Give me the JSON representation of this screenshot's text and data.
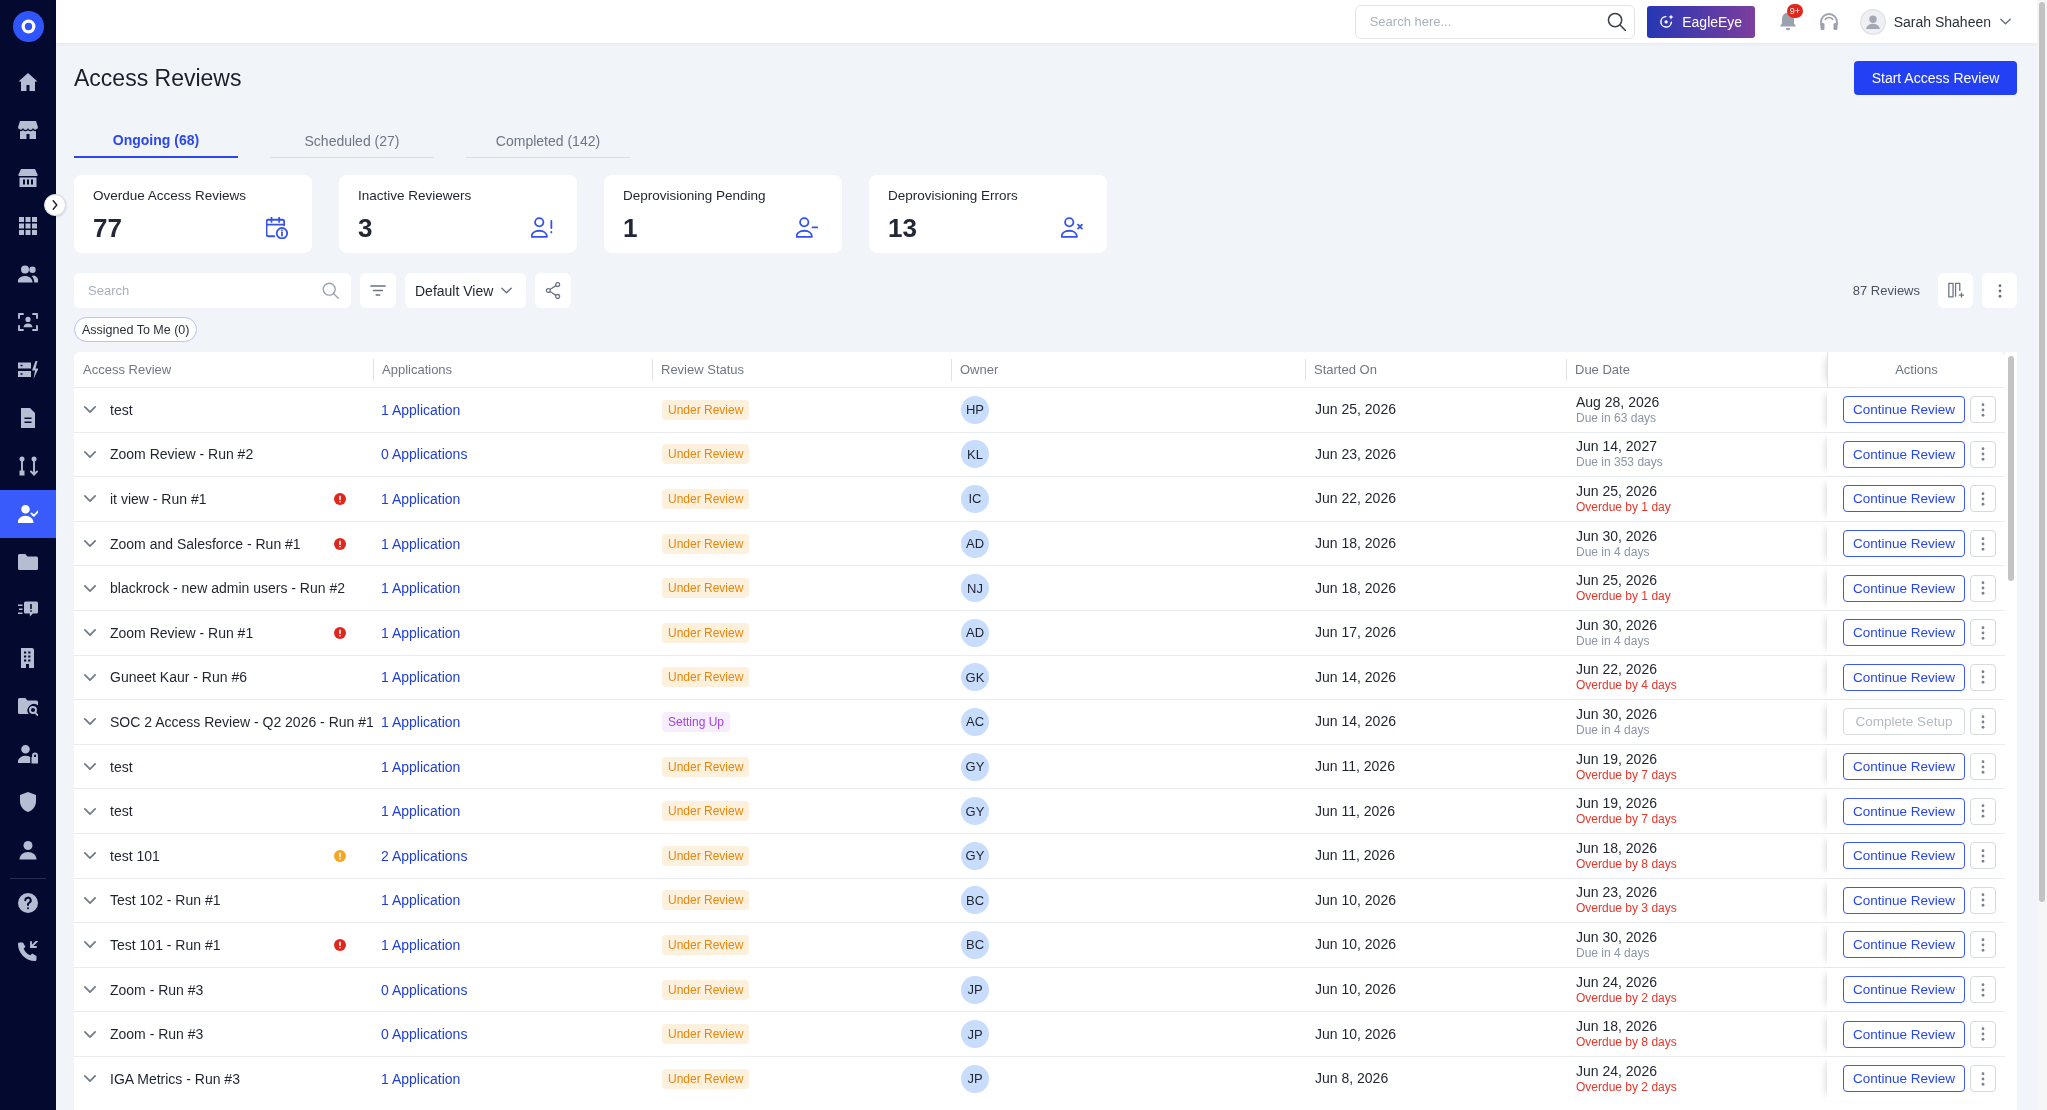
{
  "sidebar": {
    "items": [
      {
        "selected": false
      },
      {
        "selected": false
      },
      {
        "selected": false
      },
      {
        "selected": false
      },
      {
        "selected": false
      },
      {
        "selected": false
      },
      {
        "selected": false
      },
      {
        "selected": false
      },
      {
        "selected": false
      },
      {
        "selected": true
      },
      {
        "selected": false
      },
      {
        "selected": false
      },
      {
        "selected": false
      },
      {
        "selected": false
      },
      {
        "selected": false
      },
      {
        "selected": false
      },
      {
        "selected": false
      }
    ],
    "bottom_items": [
      {
        "selected": false
      },
      {
        "selected": false
      }
    ]
  },
  "topbar": {
    "search": {
      "placeholder": "Search here..."
    },
    "assistant_button": "EagleEye",
    "notification_badge": "9+",
    "user_name": "Sarah Shaheen"
  },
  "page": {
    "title": "Access Reviews",
    "primary_button": "Start Access Review"
  },
  "tabs": [
    {
      "label": "Ongoing (68)",
      "selected": true
    },
    {
      "label": "Scheduled (27)",
      "selected": false
    },
    {
      "label": "Completed (142)",
      "selected": false
    }
  ],
  "cards": [
    {
      "label": "Overdue Access Reviews",
      "value": "77"
    },
    {
      "label": "Inactive Reviewers",
      "value": "3"
    },
    {
      "label": "Deprovisioning Pending",
      "value": "1"
    },
    {
      "label": "Deprovisioning Errors",
      "value": "13"
    }
  ],
  "toolbar": {
    "search": {
      "placeholder": "Search"
    },
    "view": "Default View",
    "count": "87 Reviews",
    "filter_chip": "Assigned To Me (0)"
  },
  "table": {
    "columns": [
      "Access Review",
      "Applications",
      "Review Status",
      "Owner",
      "Started On",
      "Due Date",
      "Actions"
    ],
    "rows": [
      {
        "name": "test",
        "applications": "1 Application",
        "status": {
          "label": "Under Review",
          "kind": "review"
        },
        "owner": "HP",
        "started_on": "Jun 25, 2026",
        "due": {
          "date": "Aug 28, 2026",
          "note": "Due in 63 days",
          "overdue": false
        },
        "action": {
          "label": "Continue Review",
          "disabled": false
        }
      },
      {
        "name": "Zoom Review - Run #2",
        "applications": "0 Applications",
        "status": {
          "label": "Under Review",
          "kind": "review"
        },
        "owner": "KL",
        "started_on": "Jun 23, 2026",
        "due": {
          "date": "Jun 14, 2027",
          "note": "Due in 353 days",
          "overdue": false
        },
        "action": {
          "label": "Continue Review",
          "disabled": false
        }
      },
      {
        "name": "it view - Run #1",
        "alert": {
          "color": "#e0261d"
        },
        "applications": "1 Application",
        "status": {
          "label": "Under Review",
          "kind": "review"
        },
        "owner": "IC",
        "started_on": "Jun 22, 2026",
        "due": {
          "date": "Jun 25, 2026",
          "note": "Overdue by 1 day",
          "overdue": true
        },
        "action": {
          "label": "Continue Review",
          "disabled": false
        }
      },
      {
        "name": "Zoom and Salesforce - Run #1",
        "alert": {
          "color": "#e0261d"
        },
        "applications": "1 Application",
        "status": {
          "label": "Under Review",
          "kind": "review"
        },
        "owner": "AD",
        "started_on": "Jun 18, 2026",
        "due": {
          "date": "Jun 30, 2026",
          "note": "Due in 4 days",
          "overdue": false
        },
        "action": {
          "label": "Continue Review",
          "disabled": false
        }
      },
      {
        "name": "blackrock - new admin users - Run #2",
        "applications": "1 Application",
        "status": {
          "label": "Under Review",
          "kind": "review"
        },
        "owner": "NJ",
        "started_on": "Jun 18, 2026",
        "due": {
          "date": "Jun 25, 2026",
          "note": "Overdue by 1 day",
          "overdue": true
        },
        "action": {
          "label": "Continue Review",
          "disabled": false
        }
      },
      {
        "name": "Zoom Review - Run #1",
        "alert": {
          "color": "#e0261d"
        },
        "applications": "1 Application",
        "status": {
          "label": "Under Review",
          "kind": "review"
        },
        "owner": "AD",
        "started_on": "Jun 17, 2026",
        "due": {
          "date": "Jun 30, 2026",
          "note": "Due in 4 days",
          "overdue": false
        },
        "action": {
          "label": "Continue Review",
          "disabled": false
        }
      },
      {
        "name": "Guneet Kaur - Run #6",
        "applications": "1 Application",
        "status": {
          "label": "Under Review",
          "kind": "review"
        },
        "owner": "GK",
        "started_on": "Jun 14, 2026",
        "due": {
          "date": "Jun 22, 2026",
          "note": "Overdue by 4 days",
          "overdue": true
        },
        "action": {
          "label": "Continue Review",
          "disabled": false
        }
      },
      {
        "name": "SOC 2 Access Review - Q2 2026 - Run #1",
        "applications": "1 Application",
        "status": {
          "label": "Setting Up",
          "kind": "setup"
        },
        "owner": "AC",
        "started_on": "Jun 14, 2026",
        "due": {
          "date": "Jun 30, 2026",
          "note": "Due in 4 days",
          "overdue": false
        },
        "action": {
          "label": "Complete Setup",
          "disabled": true
        }
      },
      {
        "name": "test",
        "applications": "1 Application",
        "status": {
          "label": "Under Review",
          "kind": "review"
        },
        "owner": "GY",
        "started_on": "Jun 11, 2026",
        "due": {
          "date": "Jun 19, 2026",
          "note": "Overdue by 7 days",
          "overdue": true
        },
        "action": {
          "label": "Continue Review",
          "disabled": false
        }
      },
      {
        "name": "test",
        "applications": "1 Application",
        "status": {
          "label": "Under Review",
          "kind": "review"
        },
        "owner": "GY",
        "started_on": "Jun 11, 2026",
        "due": {
          "date": "Jun 19, 2026",
          "note": "Overdue by 7 days",
          "overdue": true
        },
        "action": {
          "label": "Continue Review",
          "disabled": false
        }
      },
      {
        "name": "test 101",
        "alert": {
          "color": "#f5a623"
        },
        "applications": "2 Applications",
        "status": {
          "label": "Under Review",
          "kind": "review"
        },
        "owner": "GY",
        "started_on": "Jun 11, 2026",
        "due": {
          "date": "Jun 18, 2026",
          "note": "Overdue by 8 days",
          "overdue": true
        },
        "action": {
          "label": "Continue Review",
          "disabled": false
        }
      },
      {
        "name": "Test 102 - Run #1",
        "applications": "1 Application",
        "status": {
          "label": "Under Review",
          "kind": "review"
        },
        "owner": "BC",
        "started_on": "Jun 10, 2026",
        "due": {
          "date": "Jun 23, 2026",
          "note": "Overdue by 3 days",
          "overdue": true
        },
        "action": {
          "label": "Continue Review",
          "disabled": false
        }
      },
      {
        "name": "Test 101 - Run #1",
        "alert": {
          "color": "#e0261d"
        },
        "applications": "1 Application",
        "status": {
          "label": "Under Review",
          "kind": "review"
        },
        "owner": "BC",
        "started_on": "Jun 10, 2026",
        "due": {
          "date": "Jun 30, 2026",
          "note": "Due in 4 days",
          "overdue": false
        },
        "action": {
          "label": "Continue Review",
          "disabled": false
        }
      },
      {
        "name": "Zoom - Run #3",
        "applications": "0 Applications",
        "status": {
          "label": "Under Review",
          "kind": "review"
        },
        "owner": "JP",
        "started_on": "Jun 10, 2026",
        "due": {
          "date": "Jun 24, 2026",
          "note": "Overdue by 2 days",
          "overdue": true
        },
        "action": {
          "label": "Continue Review",
          "disabled": false
        }
      },
      {
        "name": "Zoom - Run #3",
        "applications": "0 Applications",
        "status": {
          "label": "Under Review",
          "kind": "review"
        },
        "owner": "JP",
        "started_on": "Jun 10, 2026",
        "due": {
          "date": "Jun 18, 2026",
          "note": "Overdue by 8 days",
          "overdue": true
        },
        "action": {
          "label": "Continue Review",
          "disabled": false
        }
      },
      {
        "name": "IGA Metrics - Run #3",
        "applications": "1 Application",
        "status": {
          "label": "Under Review",
          "kind": "review"
        },
        "owner": "JP",
        "started_on": "Jun 8, 2026",
        "due": {
          "date": "Jun 24, 2026",
          "note": "Overdue by 2 days",
          "overdue": true
        },
        "action": {
          "label": "Continue Review",
          "disabled": false
        }
      }
    ]
  }
}
